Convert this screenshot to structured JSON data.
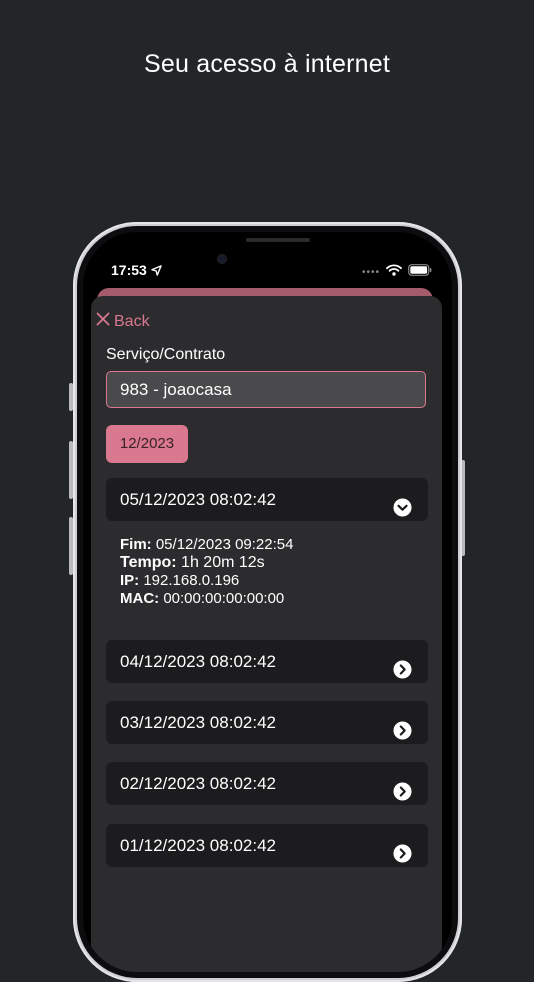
{
  "headline": "Seu acesso à internet",
  "status_bar": {
    "time": "17:53",
    "signal_dots": "••••"
  },
  "nav": {
    "back_label": "Back"
  },
  "form": {
    "service_label": "Serviço/Contrato",
    "service_value": "983 - joaocasa"
  },
  "month_filter": "12/2023",
  "sessions": [
    {
      "start": "05/12/2023 08:02:42",
      "expanded": true
    },
    {
      "start": "04/12/2023 08:02:42",
      "expanded": false
    },
    {
      "start": "03/12/2023 08:02:42",
      "expanded": false
    },
    {
      "start": "02/12/2023 08:02:42",
      "expanded": false
    },
    {
      "start": "01/12/2023 08:02:42",
      "expanded": false
    }
  ],
  "session_details": {
    "end_label": "Fim:",
    "end_value": "05/12/2023 09:22:54",
    "duration_label": "Tempo:",
    "duration_value": "1h 20m 12s",
    "ip_label": "IP:",
    "ip_value": "192.168.0.196",
    "mac_label": "MAC:",
    "mac_value": "00:00:00:00:00:00"
  },
  "colors": {
    "accent": "#d9788e",
    "background": "#232629",
    "sheet": "#2c2c2e",
    "card": "#1c1c1e"
  }
}
